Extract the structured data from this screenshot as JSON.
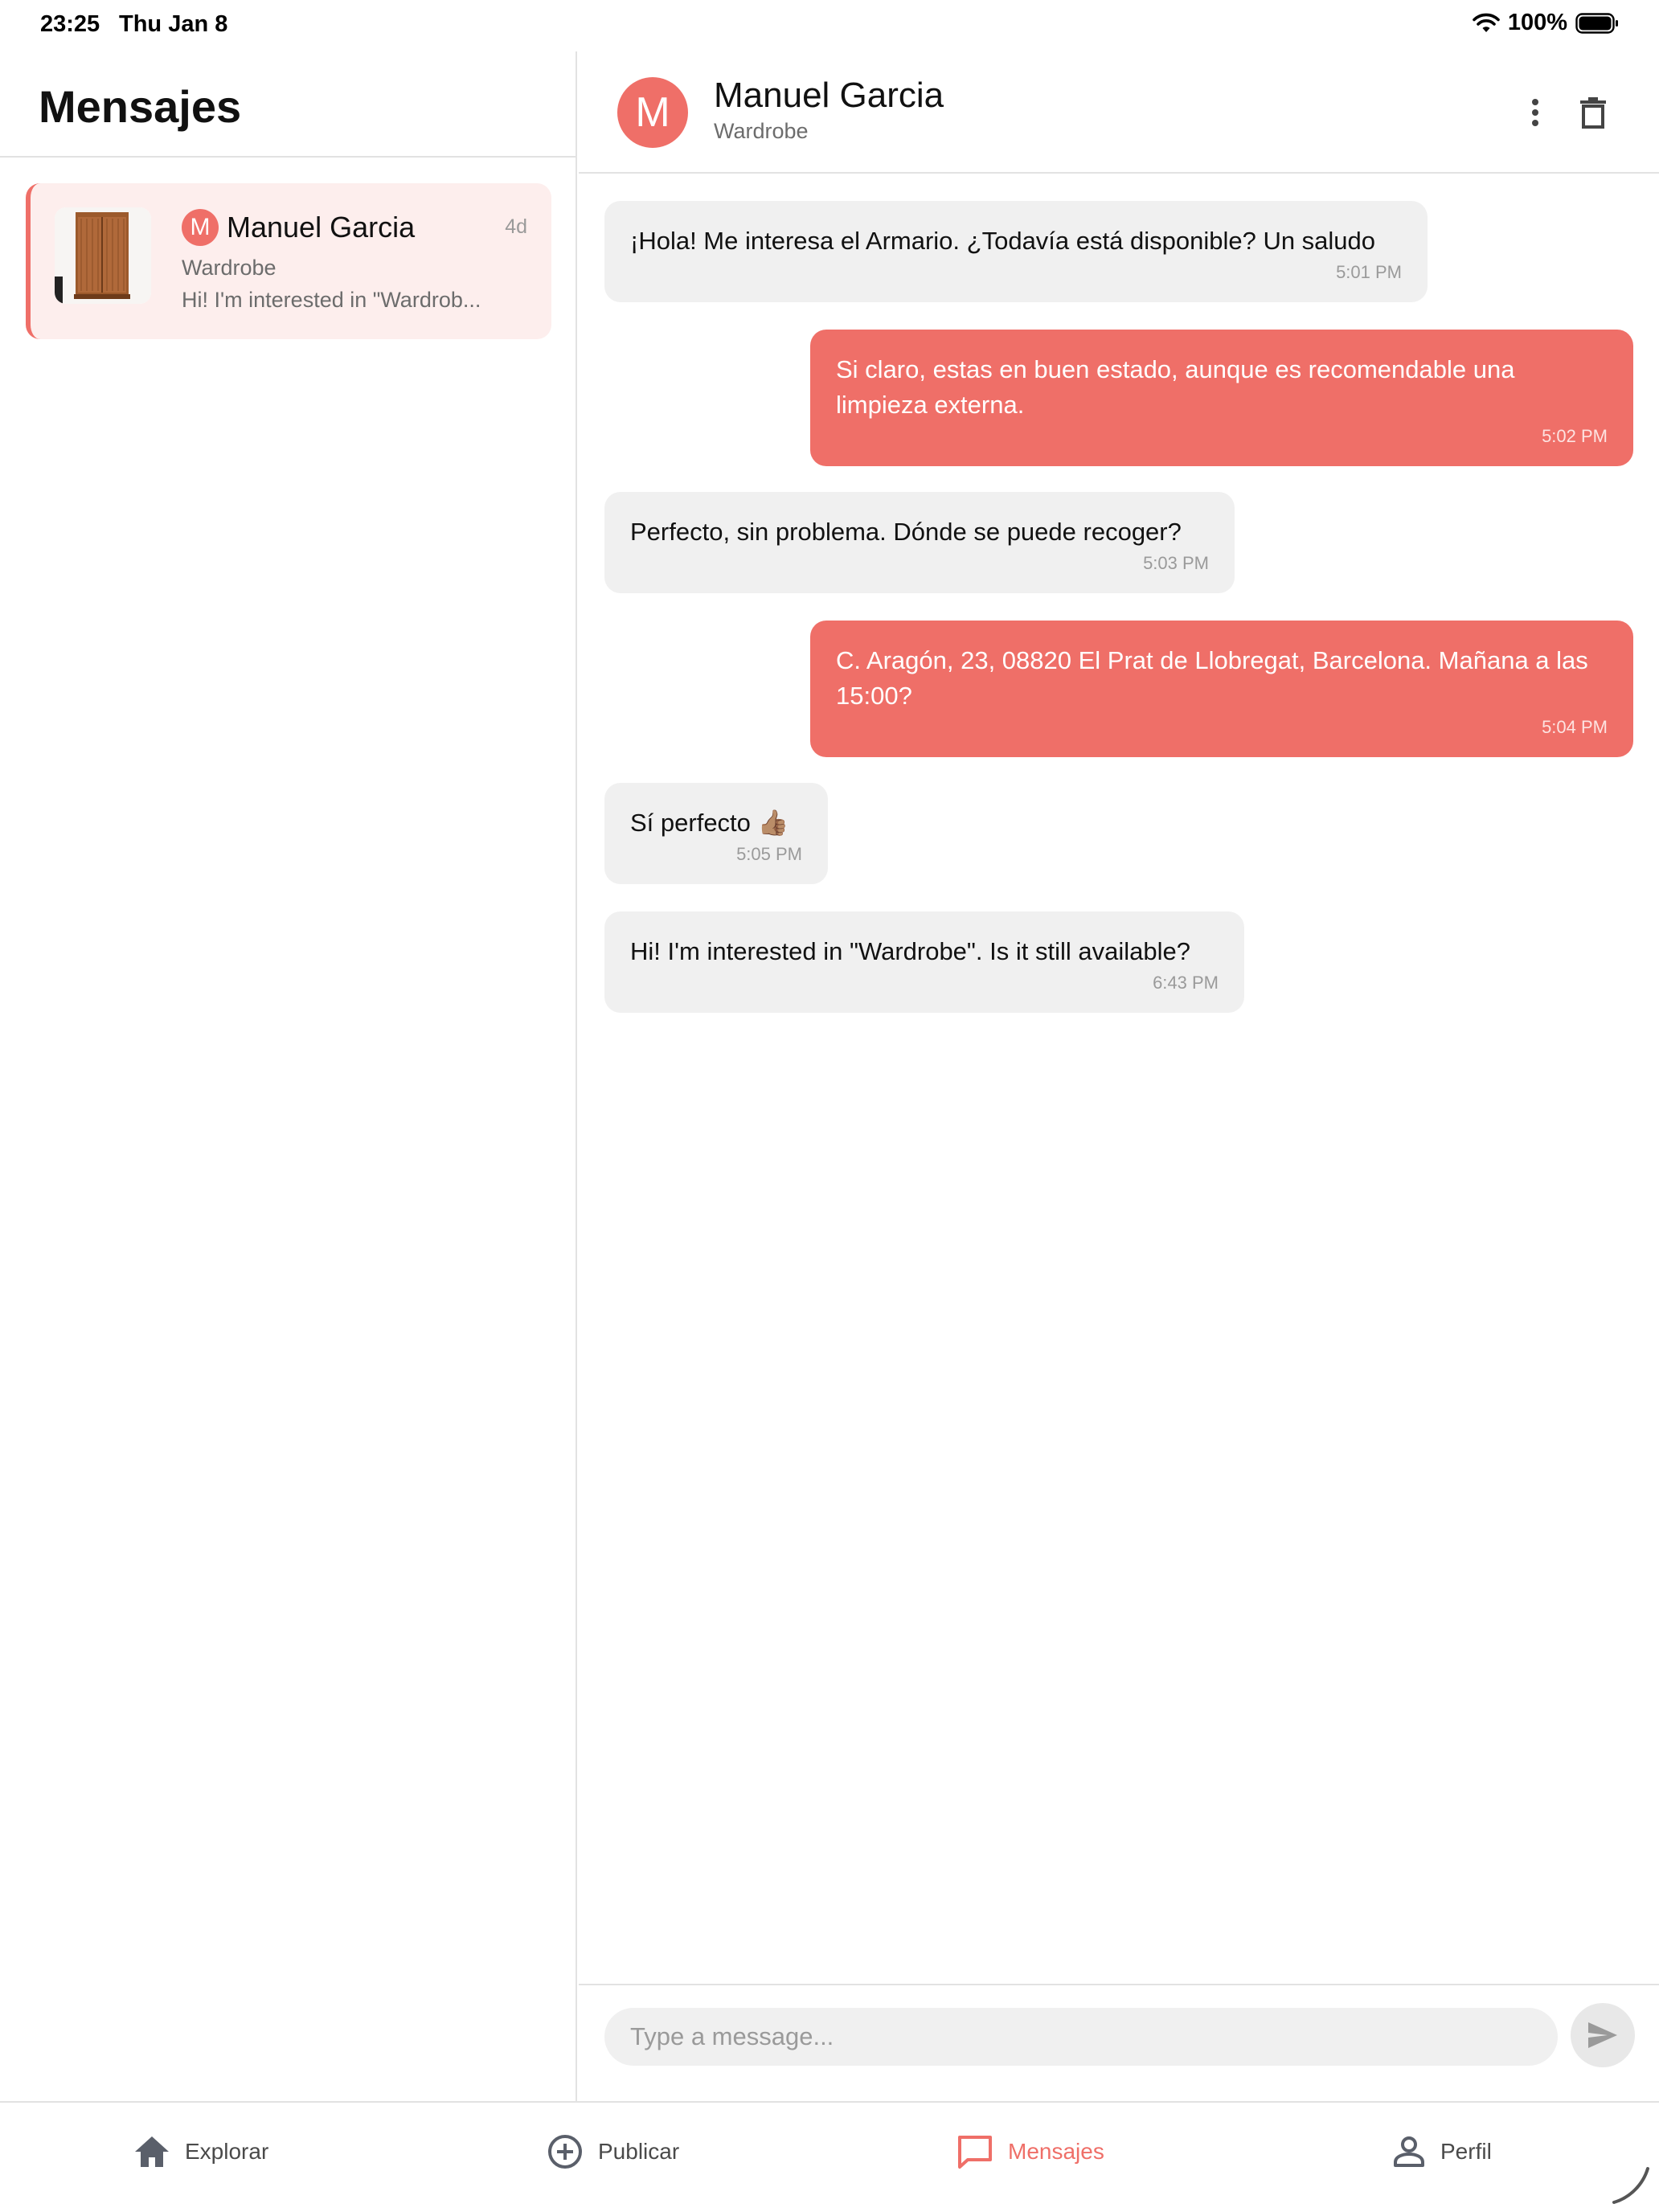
{
  "status_bar": {
    "time": "23:25",
    "date": "Thu Jan 8",
    "battery": "100%"
  },
  "sidebar": {
    "title": "Mensajes",
    "conversations": [
      {
        "avatar_letter": "M",
        "name": "Manuel Garcia",
        "time": "4d",
        "product": "Wardrobe",
        "preview": "Hi! I'm interested in \"Wardrob..."
      }
    ]
  },
  "chat": {
    "avatar_letter": "M",
    "name": "Manuel Garcia",
    "product": "Wardrobe",
    "messages": [
      {
        "direction": "in",
        "text": "¡Hola! Me interesa el Armario. ¿Todavía está disponible? Un saludo",
        "time": "5:01 PM"
      },
      {
        "direction": "out",
        "text": "Si claro, estas en buen estado, aunque es recomendable una limpieza externa.",
        "time": "5:02 PM"
      },
      {
        "direction": "in",
        "text": "Perfecto, sin problema. Dónde se puede recoger?",
        "time": "5:03 PM"
      },
      {
        "direction": "out",
        "text": "C. Aragón, 23, 08820 El Prat de Llobregat, Barcelona. Mañana a las 15:00?",
        "time": "5:04 PM"
      },
      {
        "direction": "in",
        "text": "Sí perfecto 👍🏽",
        "time": "5:05 PM"
      },
      {
        "direction": "in",
        "text": "Hi! I'm interested in \"Wardrobe\". Is it still available?",
        "time": "6:43 PM"
      }
    ],
    "composer": {
      "placeholder": "Type a message..."
    }
  },
  "bottom_nav": {
    "items": [
      {
        "label": "Explorar",
        "icon": "home-icon"
      },
      {
        "label": "Publicar",
        "icon": "plus-circle-icon"
      },
      {
        "label": "Mensajes",
        "icon": "chat-icon",
        "active": true
      },
      {
        "label": "Perfil",
        "icon": "person-icon"
      }
    ]
  },
  "colors": {
    "accent": "#ef6f68",
    "incoming_bubble": "#f0f0f0",
    "selected_row": "#fdeeed"
  }
}
